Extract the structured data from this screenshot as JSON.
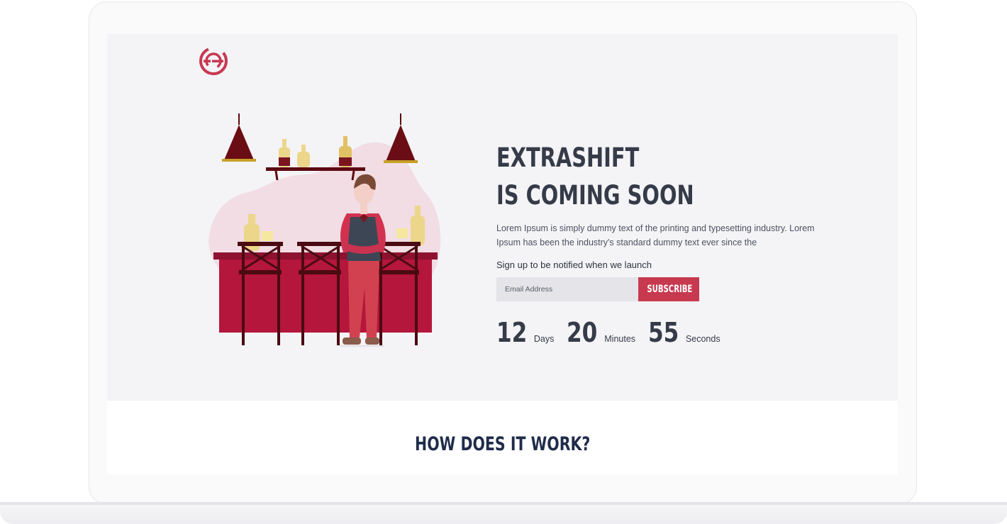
{
  "hero": {
    "headline_line1": "EXTRASHIFT",
    "headline_line2": "IS COMING SOON",
    "lead": "Lorem Ipsum is simply dummy text of the printing and typesetting industry. Lorem Ipsum has been the industry's standard dummy text ever since the",
    "signup_label": "Sign up to be notified when we launch",
    "email_placeholder": "Email Address",
    "subscribe_label": "SUBSCRIBE"
  },
  "countdown": [
    {
      "value": "12",
      "label": "Days"
    },
    {
      "value": "20",
      "label": "Minutes"
    },
    {
      "value": "55",
      "label": "Seconds"
    }
  ],
  "how": {
    "title": "HOW DOES IT WORK?"
  },
  "colors": {
    "accent": "#c7394f",
    "text": "#353b48",
    "hero_bg": "#f4f4f7",
    "bar": "#b5163b"
  },
  "icons": {
    "logo": "brand-logo-icon",
    "illustration": "bartender-illustration"
  }
}
